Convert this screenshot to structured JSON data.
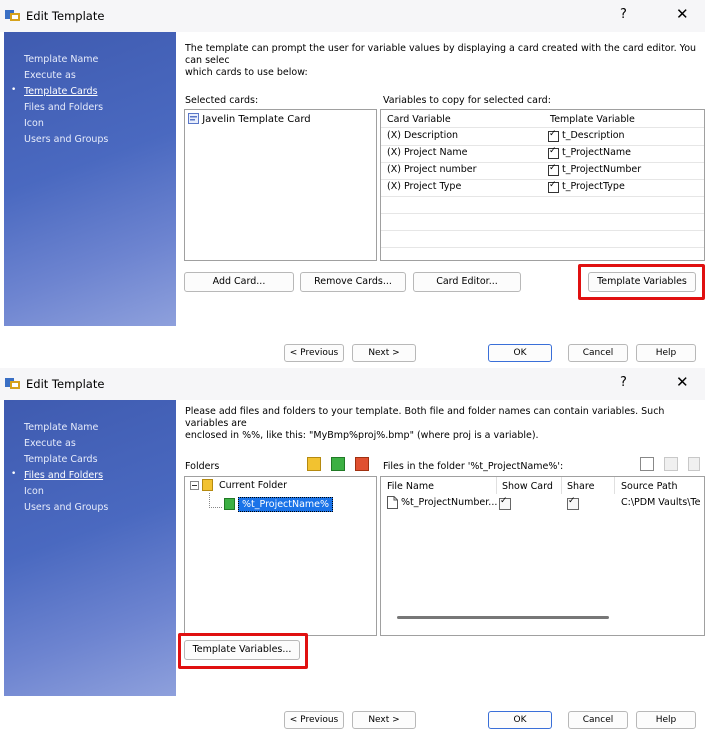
{
  "dialog1": {
    "title": "Edit Template",
    "help_glyph": "?",
    "close_glyph": "✕",
    "sidebar": [
      {
        "label": "Template Name"
      },
      {
        "label": "Execute as"
      },
      {
        "label": "Template Cards",
        "active": true
      },
      {
        "label": "Files and Folders"
      },
      {
        "label": "Icon"
      },
      {
        "label": "Users and Groups"
      }
    ],
    "intro": "The template can prompt the user for variable values by displaying a card created with the card editor. You can selec\nwhich cards to use below:",
    "selected_cards_label": "Selected cards:",
    "selected_cards": [
      "Javelin Template Card"
    ],
    "variables_label": "Variables to copy for selected card:",
    "variables_headers": {
      "card_variable": "Card Variable",
      "template_variable": "Template Variable"
    },
    "variables": [
      {
        "card": "(X) Description",
        "template": "t_Description",
        "checked": true
      },
      {
        "card": "(X) Project Name",
        "template": "t_ProjectName",
        "checked": true
      },
      {
        "card": "(X) Project number",
        "template": "t_ProjectNumber",
        "checked": true
      },
      {
        "card": "(X) Project Type",
        "template": "t_ProjectType",
        "checked": true
      }
    ],
    "buttons": {
      "add_card": "Add Card...",
      "remove_cards": "Remove Cards...",
      "card_editor": "Card Editor...",
      "template_variables": "Template Variables"
    },
    "nav": {
      "previous": "< Previous",
      "next": "Next >",
      "ok": "OK",
      "cancel": "Cancel",
      "help": "Help"
    }
  },
  "dialog2": {
    "title": "Edit Template",
    "help_glyph": "?",
    "close_glyph": "✕",
    "sidebar": [
      {
        "label": "Template Name"
      },
      {
        "label": "Execute as"
      },
      {
        "label": "Template Cards"
      },
      {
        "label": "Files and Folders",
        "active": true
      },
      {
        "label": "Icon"
      },
      {
        "label": "Users and Groups"
      }
    ],
    "intro": "Please add files and folders to your template. Both file and folder names can contain variables. Such variables are\nenclosed in %%, like this: \"MyBmp%proj%.bmp\" (where proj is a variable).",
    "folders_label": "Folders",
    "files_label": "Files in the folder '%t_ProjectName%':",
    "tree": {
      "root": "Current Folder",
      "child": "%t_ProjectName%"
    },
    "file_headers": {
      "file_name": "File Name",
      "show_card": "Show Card",
      "share": "Share",
      "source_path": "Source Path"
    },
    "files": [
      {
        "name": "%t_ProjectNumber...",
        "show_card": false,
        "share": false,
        "source_path": "C:\\PDM Vaults\\Te"
      }
    ],
    "buttons": {
      "template_variables": "Template Variables..."
    },
    "nav": {
      "previous": "< Previous",
      "next": "Next >",
      "ok": "OK",
      "cancel": "Cancel",
      "help": "Help"
    }
  },
  "colors": {
    "highlight": "#e01010",
    "sidebar": "#4a69c0",
    "selection": "#1a73e8"
  }
}
